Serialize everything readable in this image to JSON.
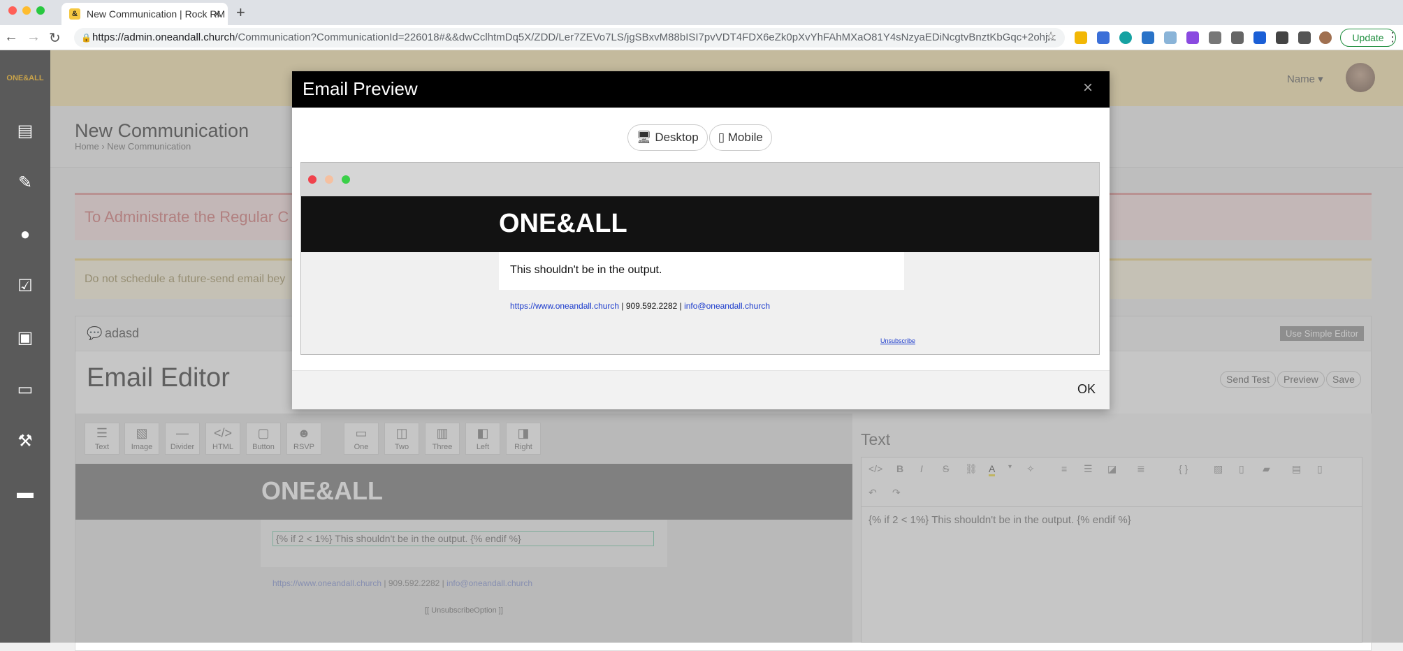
{
  "browser": {
    "tab_title": "New Communication | Rock RM",
    "tab_favicon": "&",
    "url_host": "https://admin.oneandall.church",
    "url_path": "/Communication?CommunicationId=226018#&&dwCclhtmDq5X/ZDD/Ler7ZEVo7LS/jgSBxvM88bISI7pvVDT4FDX6eZk0pXvYhFAhMXaO81Y4sNzyaEDiNcgtvBnztKbGqc+2ohj...",
    "update_label": "Update"
  },
  "app": {
    "logo": "ONE&ALL",
    "user_name": "Name ▾",
    "page_title": "New Communication",
    "breadcrumb_home": "Home",
    "breadcrumb_sep": "›",
    "breadcrumb_current": "New Communication",
    "alert_red": "To Administrate the Regular C",
    "alert_yellow": "Do not schedule a future-send email bey",
    "panel_title": "adasd",
    "simple_editor": "Use Simple Editor",
    "editor_title": "Email Editor",
    "send_test": "Send Test",
    "preview": "Preview",
    "save": "Save",
    "tools": [
      "Text",
      "Image",
      "Divider",
      "HTML",
      "Button",
      "RSVP",
      "One",
      "Two",
      "Three",
      "Left",
      "Right"
    ],
    "canvas_logo": "ONE&ALL",
    "canvas_text": "{% if 2 < 1%} This shouldn't be in the output. {% endif %}",
    "canvas_site": "https://www.oneandall.church",
    "canvas_phone": " | 909.592.2282 | ",
    "canvas_email": "info@oneandall.church",
    "canvas_unsub": "[[ UnsubscribeOption ]]",
    "text_heading": "Text",
    "rte_body": "{% if 2 < 1%} This shouldn't be in the output. {% endif %}"
  },
  "modal": {
    "title": "Email Preview",
    "close": "×",
    "desktop_label": "Desktop",
    "mobile_label": "Mobile",
    "preview_logo": "ONE&ALL",
    "preview_text": "This shouldn't be in the output.",
    "footer_site": "https://www.oneandall.church",
    "footer_phone": " | 909.592.2282 | ",
    "footer_email": "info@oneandall.church",
    "unsubscribe": "Unsubscribe",
    "ok_label": "OK"
  },
  "colors": {
    "topbar": "#fbe9b5",
    "sidebar": "#5a5a5a",
    "modal_header": "#000000",
    "link_blue": "#1a3acc"
  }
}
